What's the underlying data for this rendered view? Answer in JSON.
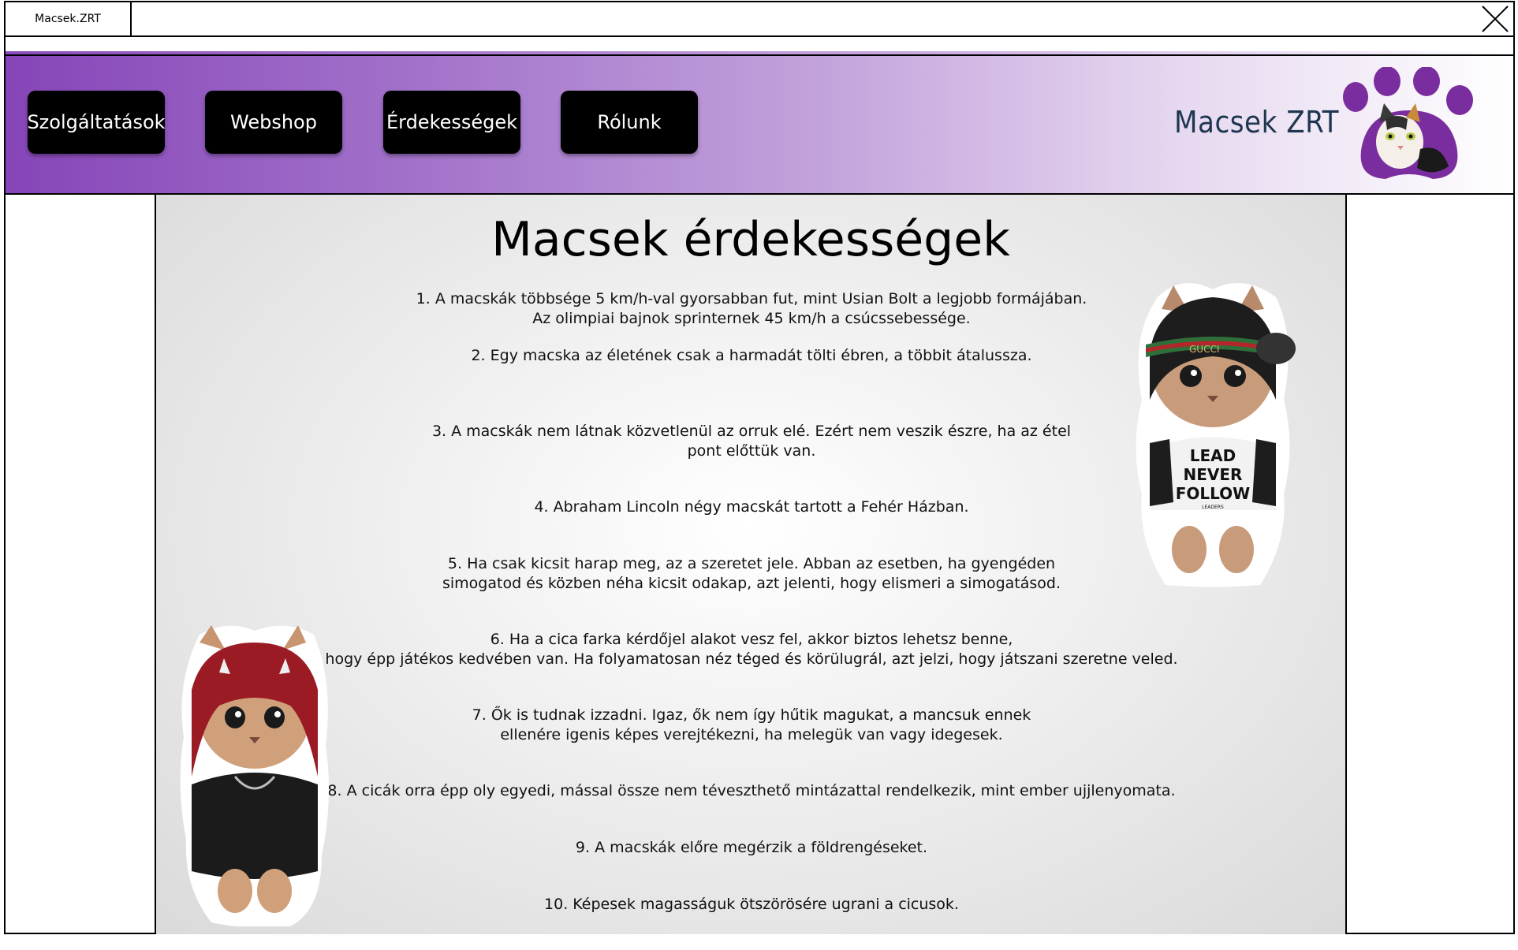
{
  "browser": {
    "tab_title": "Macsek.ZRT"
  },
  "nav": {
    "items": [
      {
        "label": "Szolgáltatások"
      },
      {
        "label": "Webshop"
      },
      {
        "label": "Érdekességek"
      },
      {
        "label": "Rólunk"
      }
    ]
  },
  "brand": {
    "name": "Macsek ZRT",
    "accent_color": "#8645b8",
    "text_color": "#1f3650"
  },
  "main": {
    "title": "Macsek érdekességek",
    "facts": [
      {
        "lines": [
          "1. A macskák többsége 5 km/h-val gyorsabban fut, mint Usian Bolt a legjobb formájában.",
          "Az olimpiai bajnok sprinternek 45 km/h a csúcssebessége."
        ]
      },
      {
        "lines": [
          "2. Egy macska az életének csak a harmadát tölti ébren, a többit átalussza."
        ]
      },
      {
        "lines": [
          "3. A macskák nem látnak közvetlenül az orruk elé. Ezért nem veszik észre, ha az étel",
          "pont előttük van."
        ]
      },
      {
        "lines": [
          "4. Abraham Lincoln négy macskát tartott a Fehér Házban."
        ]
      },
      {
        "lines": [
          "5. Ha csak kicsit harap meg, az a szeretet jele. Abban az esetben, ha gyengéden",
          "simogatod és közben néha kicsit odakap, azt jelenti, hogy elismeri a simogatásod."
        ]
      },
      {
        "lines": [
          "6. Ha a cica farka kérdőjel alakot vesz fel, akkor biztos lehetsz benne,",
          "hogy épp játékos kedvében van. Ha folyamatosan néz téged és körülugrál, azt jelzi, hogy játszani szeretne veled."
        ]
      },
      {
        "lines": [
          "7. Ők is tudnak izzadni. Igaz, ők nem így hűtik magukat, a mancsuk ennek",
          "ellenére igenis képes verejtékezni, ha melegük van vagy idegesek."
        ]
      },
      {
        "lines": [
          "8. A cicák orra épp oly egyedi, mással össze nem téveszthető mintázattal rendelkezik, mint ember ujjlenyomata."
        ]
      },
      {
        "lines": [
          "9. A macskák előre megérzik a földrengéseket."
        ]
      },
      {
        "lines": [
          "10. Képesek magasságuk ötszörösére ugrani a cicusok."
        ]
      }
    ]
  },
  "images": {
    "cat_right_shirt_lines": [
      "LEAD",
      "NEVER",
      "FOLLOW",
      "LEADERS"
    ],
    "cat_right_headband": "GUCCI"
  }
}
